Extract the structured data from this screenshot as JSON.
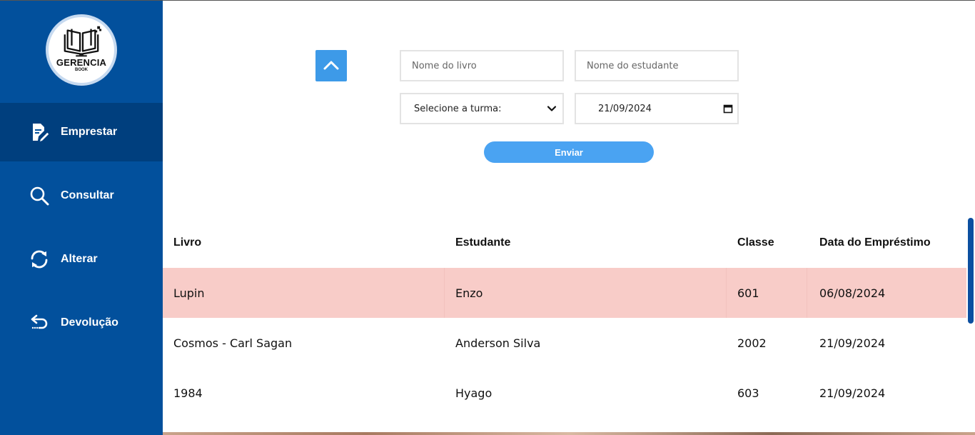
{
  "brand": {
    "name": "GERENCIA",
    "sub": "BOOK"
  },
  "sidebar": {
    "items": [
      {
        "label": "Emprestar",
        "icon": "edit-document-icon",
        "active": true
      },
      {
        "label": "Consultar",
        "icon": "search-icon",
        "active": false
      },
      {
        "label": "Alterar",
        "icon": "refresh-icon",
        "active": false
      },
      {
        "label": "Devolução",
        "icon": "return-arrow-icon",
        "active": false
      }
    ]
  },
  "form": {
    "book_placeholder": "Nome do livro",
    "student_placeholder": "Nome do estudante",
    "class_select": "Selecione a turma:",
    "date_value": "21/09/2024",
    "submit_label": "Enviar"
  },
  "table": {
    "headers": [
      "Livro",
      "Estudante",
      "Classe",
      "Data do Empréstimo"
    ],
    "rows": [
      [
        "Lupin",
        "Enzo",
        "601",
        "06/08/2024"
      ],
      [
        "Cosmos - Carl Sagan",
        "Anderson Silva",
        "2002",
        "21/09/2024"
      ],
      [
        "1984",
        "Hyago",
        "603",
        "21/09/2024"
      ]
    ]
  },
  "colors": {
    "sidebar": "#02509c",
    "sidebar_active": "#003f7e",
    "accent": "#4aa3f2",
    "highlight_row": "#f8ccc8"
  }
}
